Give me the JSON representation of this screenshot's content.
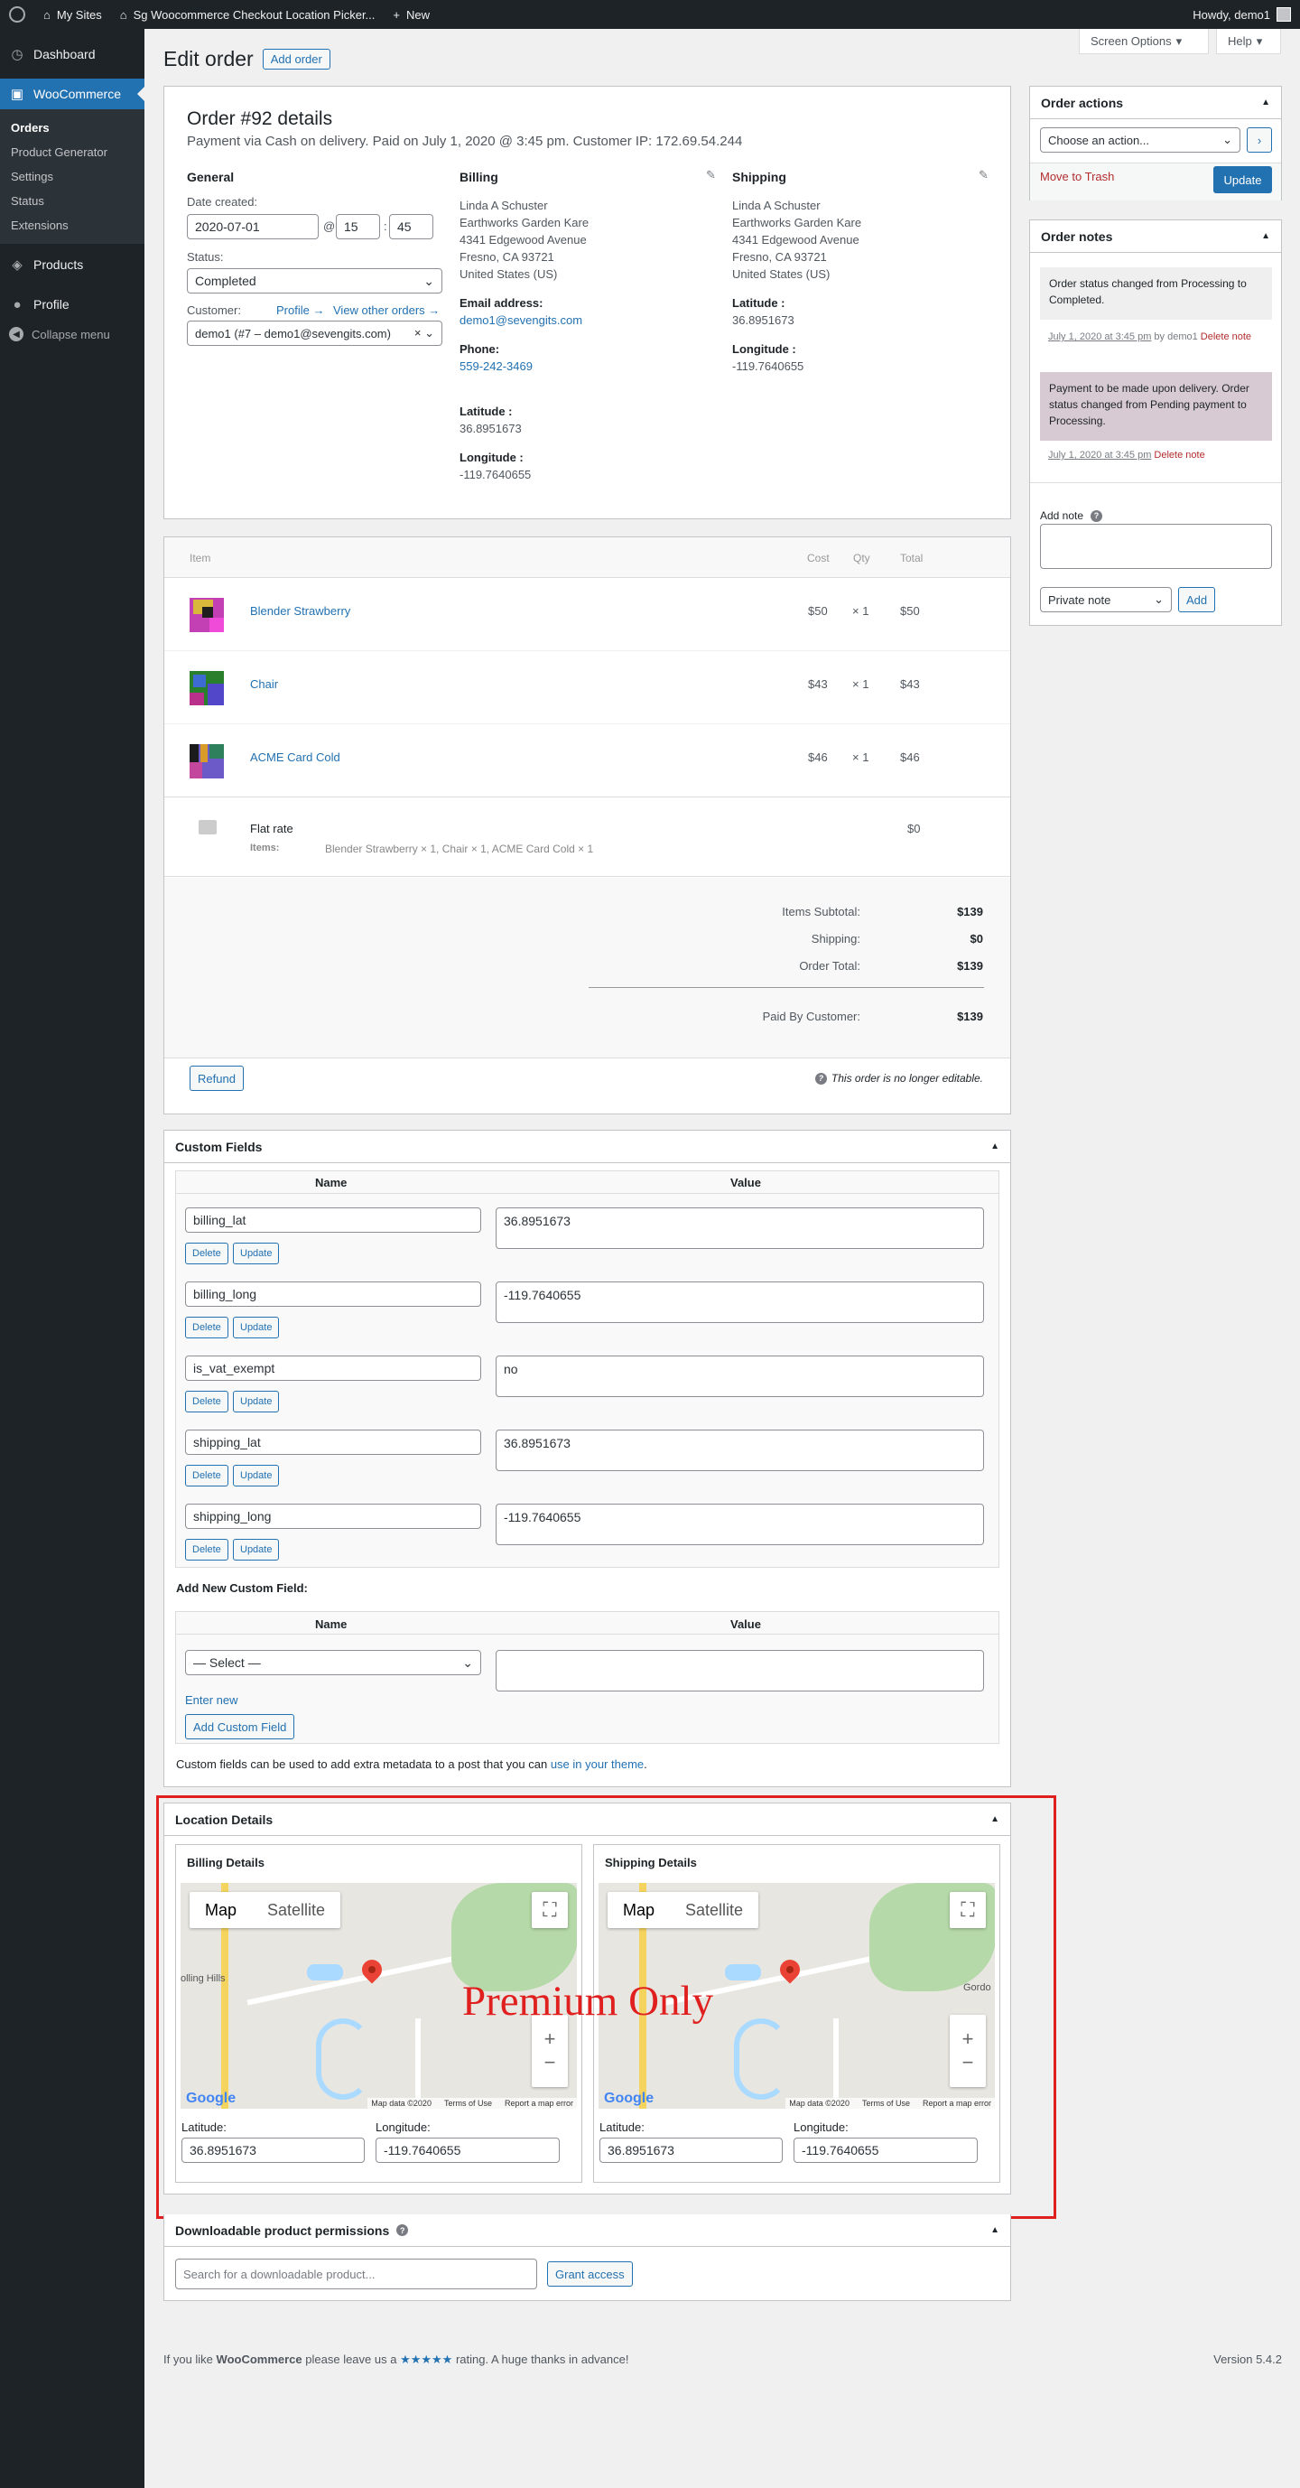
{
  "adminbar": {
    "my_sites": "My Sites",
    "site_name": "Sg Woocommerce Checkout Location Picker...",
    "new": "New",
    "howdy": "Howdy, demo1"
  },
  "sidebar": {
    "dashboard": "Dashboard",
    "woocommerce": "WooCommerce",
    "sub": [
      "Orders",
      "Product Generator",
      "Settings",
      "Status",
      "Extensions"
    ],
    "products": "Products",
    "profile": "Profile",
    "collapse": "Collapse menu"
  },
  "screen_options": "Screen Options",
  "help": "Help",
  "page": {
    "title": "Edit order",
    "add_order": "Add order"
  },
  "order": {
    "heading": "Order #92 details",
    "meta": "Payment via Cash on delivery. Paid on July 1, 2020 @ 3:45 pm. Customer IP: 172.69.54.244",
    "general": {
      "title": "General",
      "date_label": "Date created:",
      "date": "2020-07-01",
      "at": "@",
      "hour": "15",
      "sep": ":",
      "minute": "45",
      "status_label": "Status:",
      "status": "Completed",
      "customer_label": "Customer:",
      "profile_link": "Profile →",
      "other_orders_link": "View other orders →",
      "customer": "demo1 (#7 – demo1@sevengits.com)"
    },
    "billing": {
      "title": "Billing",
      "lines": [
        "Linda A Schuster",
        "Earthworks Garden Kare",
        "4341 Edgewood Avenue",
        "Fresno, CA 93721",
        "United States (US)"
      ],
      "email_label": "Email address:",
      "email": "demo1@sevengits.com",
      "phone_label": "Phone:",
      "phone": "559-242-3469",
      "lat_label": "Latitude :",
      "lat": "36.8951673",
      "long_label": "Longitude :",
      "long": "-119.7640655"
    },
    "shipping": {
      "title": "Shipping",
      "lines": [
        "Linda A Schuster",
        "Earthworks Garden Kare",
        "4341 Edgewood Avenue",
        "Fresno, CA 93721",
        "United States (US)"
      ],
      "lat_label": "Latitude :",
      "lat": "36.8951673",
      "long_label": "Longitude :",
      "long": "-119.7640655"
    }
  },
  "items": {
    "headers": {
      "item": "Item",
      "cost": "Cost",
      "qty": "Qty",
      "total": "Total"
    },
    "rows": [
      {
        "name": "Blender Strawberry",
        "cost": "$50",
        "qty": "× 1",
        "total": "$50"
      },
      {
        "name": "Chair",
        "cost": "$43",
        "qty": "× 1",
        "total": "$43"
      },
      {
        "name": "ACME Card Cold",
        "cost": "$46",
        "qty": "× 1",
        "total": "$46"
      }
    ],
    "shipping": {
      "name": "Flat rate",
      "items_label": "Items:",
      "items": "Blender Strawberry × 1, Chair × 1, ACME Card Cold × 1",
      "total": "$0"
    },
    "totals": {
      "subtotal_label": "Items Subtotal:",
      "subtotal": "$139",
      "shipping_label": "Shipping:",
      "shipping": "$0",
      "order_total_label": "Order Total:",
      "order_total": "$139",
      "paid_label": "Paid By Customer:",
      "paid": "$139"
    },
    "refund": "Refund",
    "not_editable": "This order is no longer editable."
  },
  "custom_fields": {
    "title": "Custom Fields",
    "name_header": "Name",
    "value_header": "Value",
    "rows": [
      {
        "name": "billing_lat",
        "value": "36.8951673"
      },
      {
        "name": "billing_long",
        "value": "-119.7640655"
      },
      {
        "name": "is_vat_exempt",
        "value": "no"
      },
      {
        "name": "shipping_lat",
        "value": "36.8951673"
      },
      {
        "name": "shipping_long",
        "value": "-119.7640655"
      }
    ],
    "delete": "Delete",
    "update": "Update",
    "add_new_title": "Add New Custom Field:",
    "select": "— Select —",
    "enter_new": "Enter new",
    "add_button": "Add Custom Field",
    "footnote": "Custom fields can be used to add extra metadata to a post that you can",
    "footnote_link": "use in your theme",
    "footnote_end": "."
  },
  "location": {
    "title": "Location Details",
    "premium": "Premium Only",
    "map_label": "Map",
    "satellite_label": "Satellite",
    "map_data": "Map data ©2020",
    "terms": "Terms of Use",
    "report": "Report a map error",
    "google": "Google",
    "billing": {
      "title": "Billing Details",
      "lat_label": "Latitude:",
      "lat": "36.8951673",
      "long_label": "Longitude:",
      "long": "-119.7640655"
    },
    "shipping": {
      "title": "Shipping Details",
      "lat_label": "Latitude:",
      "lat": "36.8951673",
      "long_label": "Longitude:",
      "long": "-119.7640655"
    },
    "map_text": {
      "rolling_hills": "olling Hills",
      "gordo": "Gordo",
      "google_small": "Google"
    }
  },
  "downloads": {
    "title": "Downloadable product permissions",
    "placeholder": "Search for a downloadable product...",
    "grant": "Grant access"
  },
  "order_actions": {
    "title": "Order actions",
    "select": "Choose an action...",
    "trash": "Move to Trash",
    "update": "Update"
  },
  "notes": {
    "title": "Order notes",
    "list": [
      {
        "text": "Order status changed from Processing to Completed.",
        "date": "July 1, 2020 at 3:45 pm",
        "by": " by demo1 ",
        "delete": "Delete note"
      },
      {
        "text": "Payment to be made upon delivery. Order status changed from Pending payment to Processing.",
        "date": "July 1, 2020 at 3:45 pm",
        "by": " ",
        "delete": "Delete note"
      }
    ],
    "add_label": "Add note",
    "type": "Private note",
    "add": "Add"
  },
  "footer": {
    "prefix": "If you like ",
    "brand": "WooCommerce",
    "mid": " please leave us a ",
    "stars": "★★★★★",
    "suffix": " rating. A huge thanks in advance!",
    "version": "Version 5.4.2"
  },
  "colors": {
    "accent": "#2271b1",
    "sidebar": "#1d2327",
    "highlight": "#e0201f",
    "note_customer": "#d7cad2",
    "note_system": "#efefef"
  }
}
